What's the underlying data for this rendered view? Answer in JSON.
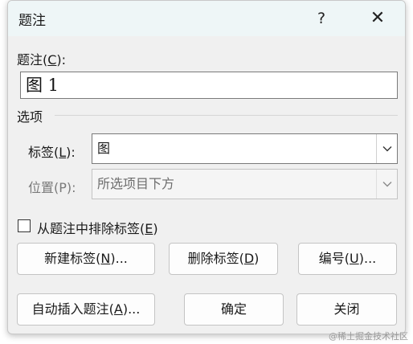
{
  "dialog": {
    "title": "题注",
    "help_glyph": "?",
    "close_glyph": "✕"
  },
  "caption": {
    "label_prefix": "题注(",
    "label_key": "C",
    "label_suffix": "):",
    "value": "图 1"
  },
  "options": {
    "group_label": "选项",
    "label_field": {
      "label_prefix": "标签(",
      "label_key": "L",
      "label_suffix": "):",
      "value": "图",
      "enabled": true
    },
    "position_field": {
      "label": "位置(P):",
      "value": "所选项目下方",
      "enabled": false
    },
    "exclude_label": {
      "text_prefix": "从题注中排除标签(",
      "text_key": "E",
      "text_suffix": ")",
      "checked": false
    }
  },
  "buttons": {
    "new_label": {
      "prefix": "新建标签(",
      "key": "N",
      "suffix": ")..."
    },
    "delete_label": {
      "prefix": "删除标签(",
      "key": "D",
      "suffix": ")"
    },
    "numbering": {
      "prefix": "编号(",
      "key": "U",
      "suffix": ")..."
    },
    "auto_caption": {
      "prefix": "自动插入题注(",
      "key": "A",
      "suffix": ")..."
    },
    "ok": "确定",
    "close": "关闭"
  },
  "watermark": "@稀土掘金技术社区",
  "colors": {
    "titlebar_bg": "#eef6f7",
    "dialog_bg": "#f0f0f0",
    "disabled_text": "#7a7a7a"
  },
  "icons": [
    "help-icon",
    "close-icon",
    "chevron-down-icon"
  ]
}
